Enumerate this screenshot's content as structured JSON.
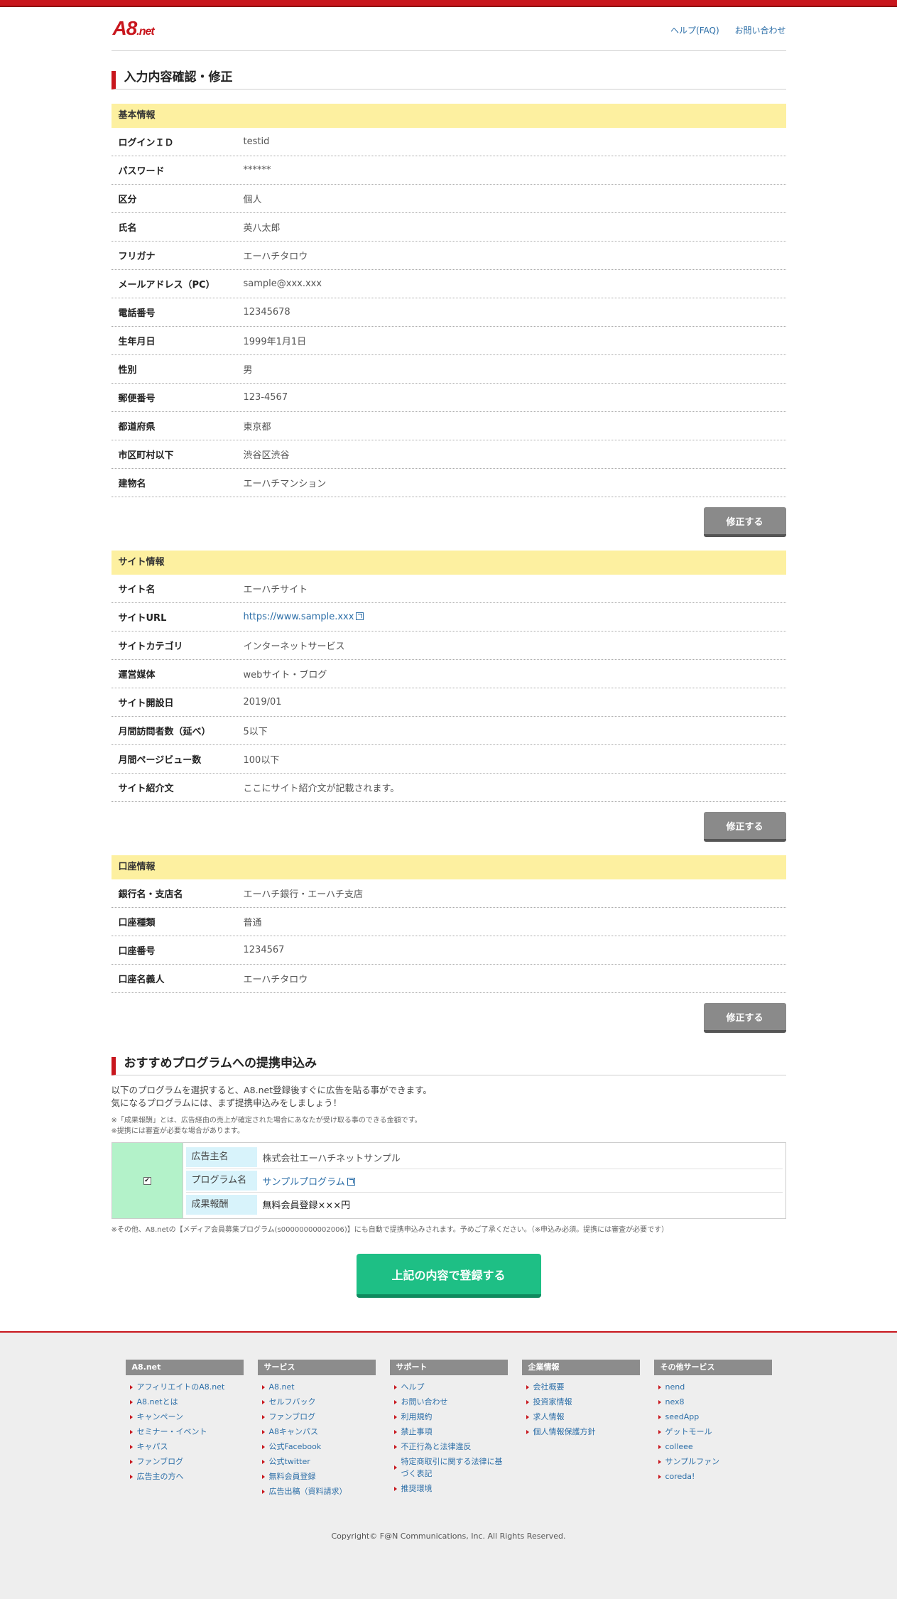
{
  "header": {
    "logo_main": "A8",
    "logo_sub": ".net",
    "links": [
      "ヘルプ(FAQ)",
      "お問い合わせ"
    ]
  },
  "page_title": "入力内容確認・修正",
  "basic": {
    "title": "基本情報",
    "rows": [
      {
        "k": "ログインＩＤ",
        "v": "testid"
      },
      {
        "k": "パスワード",
        "v": "******"
      },
      {
        "k": "区分",
        "v": "個人"
      },
      {
        "k": "氏名",
        "v": "英八太郎"
      },
      {
        "k": "フリガナ",
        "v": "エーハチタロウ"
      },
      {
        "k": "メールアドレス（PC）",
        "v": "sample@xxx.xxx"
      },
      {
        "k": "電話番号",
        "v": "12345678"
      },
      {
        "k": "生年月日",
        "v": "1999年1月1日"
      },
      {
        "k": "性別",
        "v": "男"
      },
      {
        "k": "郵便番号",
        "v": "123-4567"
      },
      {
        "k": "都道府県",
        "v": "東京都"
      },
      {
        "k": "市区町村以下",
        "v": "渋谷区渋谷"
      },
      {
        "k": "建物名",
        "v": "エーハチマンション"
      }
    ]
  },
  "site": {
    "title": "サイト情報",
    "rows": [
      {
        "k": "サイト名",
        "v": "エーハチサイト"
      },
      {
        "k": "サイトURL",
        "v": "https://www.sample.xxx"
      },
      {
        "k": "サイトカテゴリ",
        "v": "インターネットサービス"
      },
      {
        "k": "運営媒体",
        "v": "webサイト・ブログ"
      },
      {
        "k": "サイト開設日",
        "v": "2019/01"
      },
      {
        "k": "月間訪問者数（延べ）",
        "v": "5以下"
      },
      {
        "k": "月間ページビュー数",
        "v": "100以下"
      },
      {
        "k": "サイト紹介文",
        "v": "ここにサイト紹介文が記載されます。"
      }
    ]
  },
  "bank": {
    "title": "口座情報",
    "rows": [
      {
        "k": "銀行名・支店名",
        "v": "エーハチ銀行・エーハチ支店"
      },
      {
        "k": "口座種類",
        "v": "普通"
      },
      {
        "k": "口座番号",
        "v": "1234567"
      },
      {
        "k": "口座名義人",
        "v": "エーハチタロウ"
      }
    ]
  },
  "edit_label": "修正する",
  "recommend": {
    "title": "おすすめプログラムへの提携申込み",
    "intro1": "以下のプログラムを選択すると、A8.net登録後すぐに広告を貼る事ができます。",
    "intro2": "気になるプログラムには、まず提携申込みをしましょう！",
    "note1": "※「成果報酬」とは、広告経由の売上が確定された場合にあなたが受け取る事のできる金額です。",
    "note2": "※提携には審査が必要な場合があります。",
    "checked": true,
    "check_mark": "✔",
    "program": {
      "advertiser_label": "広告主名",
      "advertiser": "株式会社エーハチネットサンプル",
      "program_label": "プログラム名",
      "program": "サンプルプログラム",
      "reward_label": "成果報酬",
      "reward": "無料会員登録×××円"
    },
    "footnote": "※その他、A8.netの【メディア会員募集プログラム(s00000000002006)】にも自動で提携申込みされます。予めご了承ください。（※申込み必須。提携には審査が必要です）"
  },
  "submit_label": "上記の内容で登録する",
  "footer": {
    "columns": [
      {
        "title": "A8.net",
        "items": [
          "アフィリエイトのA8.net",
          "A8.netとは",
          "キャンペーン",
          "セミナー・イベント",
          "キャパス",
          "ファンブログ",
          "広告主の方へ"
        ]
      },
      {
        "title": "サービス",
        "items": [
          "A8.net",
          "セルフバック",
          "ファンブログ",
          "A8キャンパス",
          "公式Facebook",
          "公式twitter",
          "無料会員登録",
          "広告出稿（資料請求）"
        ]
      },
      {
        "title": "サポート",
        "items": [
          "ヘルプ",
          "お問い合わせ",
          "利用規約",
          "禁止事項",
          "不正行為と法律違反",
          "特定商取引に関する法律に基づく表記",
          "推奨環境"
        ]
      },
      {
        "title": "企業情報",
        "items": [
          "会社概要",
          "投資家情報",
          "求人情報",
          "個人情報保護方針"
        ]
      },
      {
        "title": "その他サービス",
        "items": [
          "nend",
          "nex8",
          "seedApp",
          "ゲットモール",
          "colleee",
          "サンプルファン",
          "coreda!"
        ]
      }
    ],
    "copyright": "Copyright© F@N Communications, Inc. All Rights Reserved."
  }
}
